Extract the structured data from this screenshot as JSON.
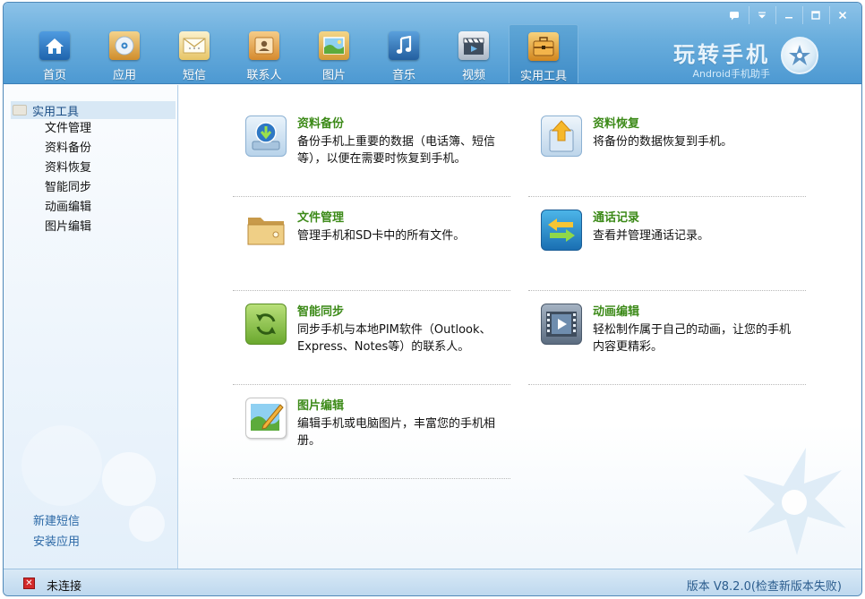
{
  "window": {
    "controls": [
      "feedback-icon",
      "dropdown-icon",
      "minimize-icon",
      "maximize-icon",
      "close-icon"
    ]
  },
  "nav": {
    "items": [
      {
        "label": "首页",
        "icon": "home-icon",
        "color": "#2f7fc6"
      },
      {
        "label": "应用",
        "icon": "cd-icon",
        "color": "#e0a940"
      },
      {
        "label": "短信",
        "icon": "envelope-icon",
        "color": "#f2d27a"
      },
      {
        "label": "联系人",
        "icon": "contact-card-icon",
        "color": "#e5a24b"
      },
      {
        "label": "图片",
        "icon": "landscape-picture-icon",
        "color": "#6ab44a"
      },
      {
        "label": "音乐",
        "icon": "music-note-icon",
        "color": "#3b7fc0"
      },
      {
        "label": "视频",
        "icon": "clapperboard-icon",
        "color": "#6f7f93"
      },
      {
        "label": "实用工具",
        "icon": "toolbox-icon",
        "color": "#e9a13a"
      }
    ],
    "active_index": 7
  },
  "brand": {
    "title": "玩转手机",
    "subtitle": "Android手机助手"
  },
  "sidebar": {
    "header": "实用工具",
    "items": [
      "文件管理",
      "资料备份",
      "资料恢复",
      "智能同步",
      "动画编辑",
      "图片编辑"
    ],
    "links": [
      "新建短信",
      "安装应用"
    ]
  },
  "tools": [
    {
      "title": "资料备份",
      "desc": "备份手机上重要的数据（电话簿、短信等），以便在需要时恢复到手机。",
      "icon": "backup-download-icon"
    },
    {
      "title": "资料恢复",
      "desc": "将备份的数据恢复到手机。",
      "icon": "restore-upload-icon"
    },
    {
      "title": "文件管理",
      "desc": "管理手机和SD卡中的所有文件。",
      "icon": "folder-icon"
    },
    {
      "title": "通话记录",
      "desc": "查看并管理通话记录。",
      "icon": "call-log-arrows-icon"
    },
    {
      "title": "智能同步",
      "desc": "同步手机与本地PIM软件（Outlook、Express、Notes等）的联系人。",
      "icon": "sync-icon"
    },
    {
      "title": "动画编辑",
      "desc": "轻松制作属于自己的动画，让您的手机内容更精彩。",
      "icon": "film-play-icon"
    },
    {
      "title": "图片编辑",
      "desc": "编辑手机或电脑图片，丰富您的手机相册。",
      "icon": "picture-edit-icon"
    }
  ],
  "status": {
    "connection": "未连接",
    "version": "版本 V8.2.0(检查新版本失败)"
  }
}
